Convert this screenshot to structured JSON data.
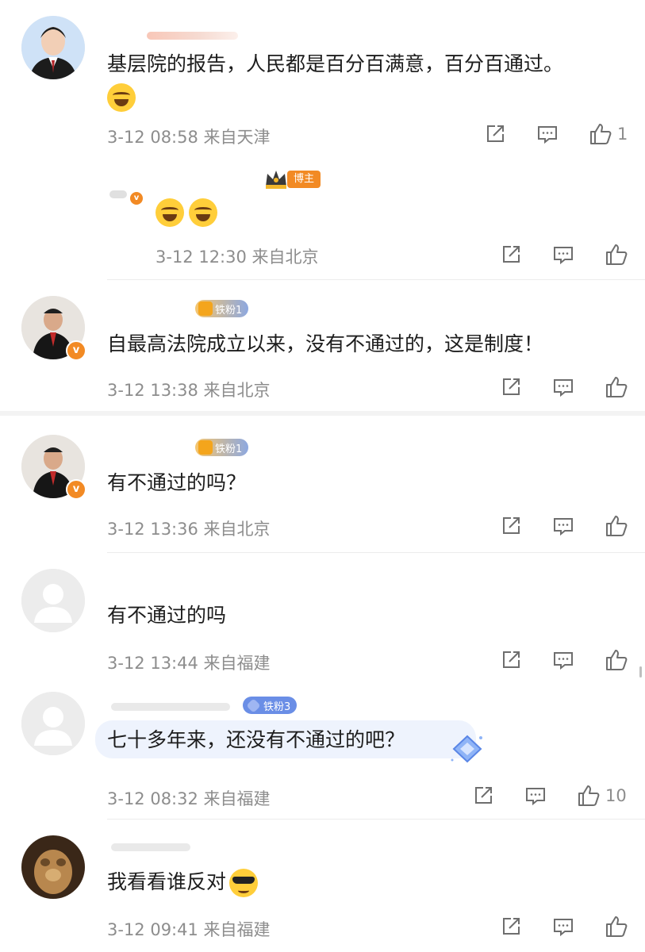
{
  "comments": [
    {
      "text": "基层院的报告，人民都是百分百满意，百分百通过。",
      "meta": "3-12 08:58 来自天津",
      "likes": "1"
    },
    {
      "text": "",
      "meta": "3-12 12:30 来自北京",
      "likes": "",
      "badge": "博主"
    },
    {
      "text": "自最高法院成立以来，没有不通过的，这是制度！",
      "meta": "3-12 13:38 来自北京",
      "likes": "",
      "badge": "铁粉1"
    },
    {
      "text": "有不通过的吗？",
      "meta": "3-12 13:36 来自北京",
      "likes": "",
      "badge": "铁粉1"
    },
    {
      "text": "有不通过的吗",
      "meta": "3-12 13:44 来自福建",
      "likes": ""
    },
    {
      "text": "七十多年来，还没有不通过的吧？",
      "meta": "3-12 08:32 来自福建",
      "likes": "10",
      "badge": "铁粉3"
    },
    {
      "text": "我看看谁反对",
      "meta": "3-12 09:41 来自福建",
      "likes": ""
    }
  ],
  "icons": {
    "share": "share-icon",
    "comment": "comment-icon",
    "like": "thumbs-up-icon"
  },
  "colors": {
    "accent": "#f28a24",
    "meta": "#8d8d8d",
    "fan_blue": "#6a8ee6"
  }
}
